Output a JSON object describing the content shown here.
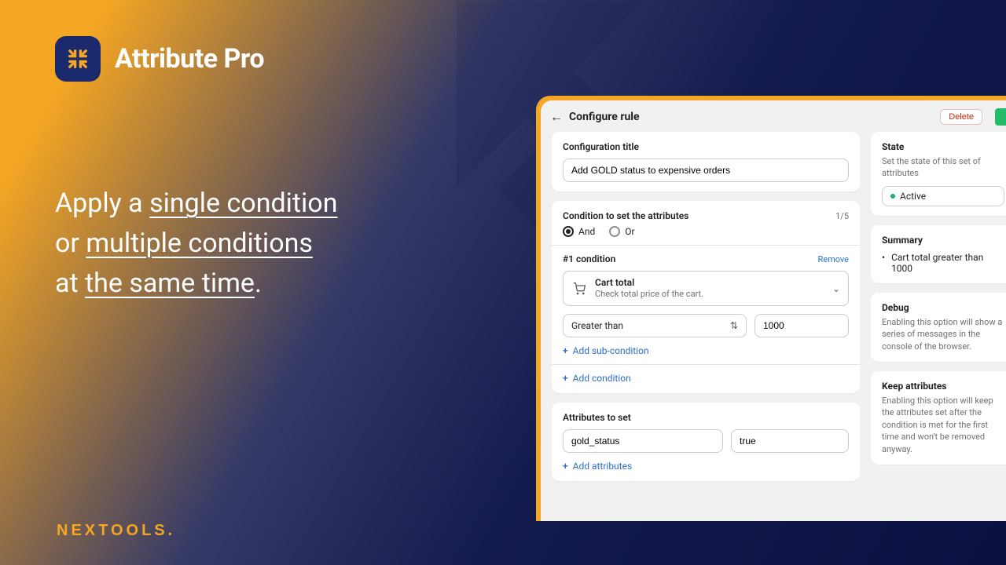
{
  "app": {
    "name": "Attribute Pro"
  },
  "promo": {
    "line1_pre": "Apply a ",
    "line1_u": "single condition",
    "line2_pre": "or ",
    "line2_u": "multiple conditions",
    "line3_pre": "at ",
    "line3_u": "the same time",
    "line3_post": "."
  },
  "brand": "NEXTOOLS.",
  "topbar": {
    "title": "Configure rule",
    "delete": "Delete"
  },
  "config": {
    "title_label": "Configuration title",
    "title_value": "Add GOLD status to expensive orders"
  },
  "conditions": {
    "header": "Condition to set the attributes",
    "count": "1/5",
    "logic": {
      "and": "And",
      "or": "Or",
      "selected": "and"
    },
    "item": {
      "label": "#1 condition",
      "remove": "Remove",
      "type_title": "Cart total",
      "type_desc": "Check total price of the cart.",
      "operator": "Greater than",
      "value": "1000",
      "add_sub": "Add sub-condition"
    },
    "add": "Add condition"
  },
  "attributes": {
    "header": "Attributes to set",
    "key": "gold_status",
    "value": "true",
    "add": "Add attributes"
  },
  "sidebar": {
    "state": {
      "title": "State",
      "desc": "Set the state of this set of attributes",
      "value": "Active"
    },
    "summary": {
      "title": "Summary",
      "item": "Cart total greater than 1000"
    },
    "debug": {
      "title": "Debug",
      "desc": "Enabling this option will show a series of messages in the console of the browser."
    },
    "keep": {
      "title": "Keep attributes",
      "desc": "Enabling this option will keep the attributes set after the condition is met for the first time and won't be removed anyway."
    }
  }
}
